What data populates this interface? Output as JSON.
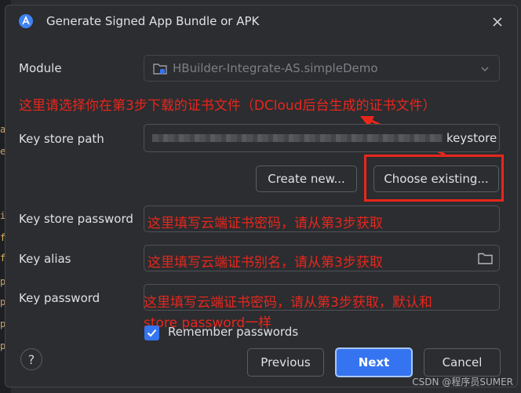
{
  "dialog": {
    "title": "Generate Signed App Bundle or APK",
    "close_icon": "close-icon",
    "app_icon": "android-studio-icon"
  },
  "module": {
    "label": "Module",
    "value": "HBuilder-Integrate-AS.simpleDemo",
    "icon": "module-folder-icon"
  },
  "keystore_path": {
    "label": "Key store path",
    "value_suffix": "keystore"
  },
  "buttons": {
    "create_new": "Create new...",
    "choose_existing": "Choose existing...",
    "previous": "Previous",
    "next": "Next",
    "cancel": "Cancel",
    "help": "?"
  },
  "keystore_password": {
    "label": "Key store password"
  },
  "key_alias": {
    "label": "Key alias",
    "icon": "folder-icon"
  },
  "key_password": {
    "label": "Key password"
  },
  "remember": {
    "label": "Remember passwords",
    "checked": true
  },
  "annotations": {
    "a1": "这里请选择你在第3步下载的证书文件（DCloud后台生成的证书文件）",
    "a2": "这里填写云端证书密码，请从第3步获取",
    "a3": "这里填写云端证书别名，请从第3步获取",
    "a4_line1": "这里填写云端证书密码，请从第3步获取，默认和",
    "a4_line2": "store password一样"
  },
  "watermark": "CSDN @程序员SUMER",
  "colors": {
    "accent": "#3574f0",
    "annotation": "#e8261c",
    "background": "#2b2d30"
  }
}
